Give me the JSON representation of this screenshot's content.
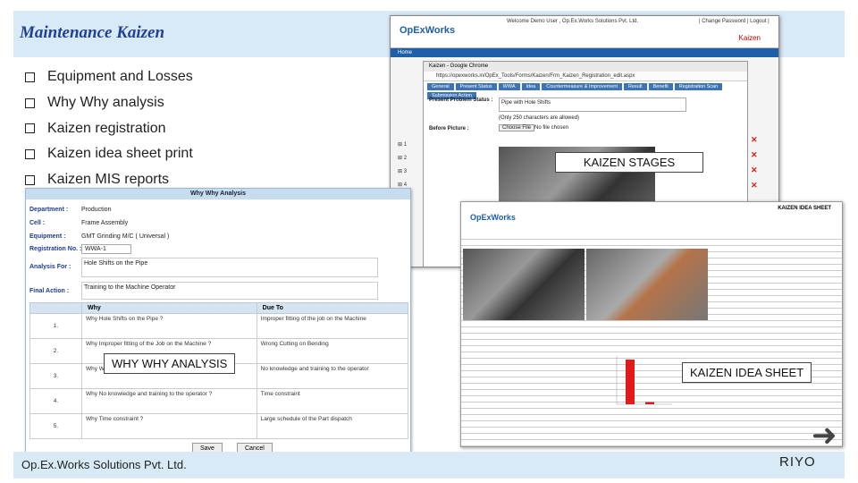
{
  "title": "Maintenance Kaizen",
  "bullets": [
    "Equipment and Losses",
    "Why Why analysis",
    "Kaizen registration",
    "Kaizen idea sheet print",
    "Kaizen MIS reports"
  ],
  "labels": {
    "stages": "KAIZEN STAGES",
    "why": "WHY WHY ANALYSIS",
    "idea": "KAIZEN IDEA SHEET"
  },
  "footer": {
    "company": "Op.Ex.Works Solutions Pvt. Ltd.",
    "brand": "RIYO"
  },
  "why_form": {
    "heading": "Why Why Analysis",
    "fields": [
      {
        "label": "Department :",
        "value": "Production"
      },
      {
        "label": "Cell :",
        "value": "Frame Assembly"
      },
      {
        "label": "Equipment :",
        "value": "GMT Grinding M/C ( Universal )"
      },
      {
        "label": "Registration No. :",
        "value": "WWA-1"
      },
      {
        "label": "Analysis For :",
        "value": "Hole Shifts on the Pipe"
      },
      {
        "label": "Final Action :",
        "value": "Training to the Machine Operator"
      }
    ],
    "col_why": "Why",
    "col_due": "Due To",
    "rows": [
      {
        "n": "1.",
        "why": "Why Hole Shifts on the Pipe ?",
        "due": "Improper fitting of the job on the Machine"
      },
      {
        "n": "2.",
        "why": "Why Improper fitting of the Job on the Machine ?",
        "due": "Wrong Cutting on Bending"
      },
      {
        "n": "3.",
        "why": "Why Wrong Cutting on Bending ?",
        "due": "No knowledge and training to the operator"
      },
      {
        "n": "4.",
        "why": "Why No knowledge and training to the operator ?",
        "due": "Time constraint"
      },
      {
        "n": "5.",
        "why": "Why Time constraint ?",
        "due": "Large schedule of the Part dispatch"
      }
    ],
    "save": "Save",
    "cancel": "Cancel"
  },
  "browser": {
    "logo": "OpExWorks",
    "welcome": "Welcome Demo User , Op.Ex.Works Solutions Pvt. Ltd.",
    "links": "| Change Password | Logout |",
    "kaizen": "Kaizen",
    "nav": "Home",
    "window_title": "Kaizen - Google Chrome",
    "url": "https://opexworks.in/OpEx_Tools/Forms/Kaizen/Frm_Kaizen_Registration_edit.aspx",
    "tabs": [
      "General",
      "Present Status",
      "WWA",
      "Idea",
      "Countermeasure & Improvement",
      "Result",
      "Benefit",
      "Registration Scan",
      "Submission Action"
    ],
    "problem_label": "Present Problem Status :",
    "problem_value": "Pipe with Hole Shifts",
    "hint": "(Only 250 characters are allowed)",
    "choose": "Choose File",
    "nofile": "No file chosen",
    "before_label": "Before Picture :"
  },
  "idea_sheet": {
    "logo": "OpExWorks",
    "title": "KAIZEN IDEA SHEET",
    "chart_values": [
      100,
      5
    ]
  }
}
